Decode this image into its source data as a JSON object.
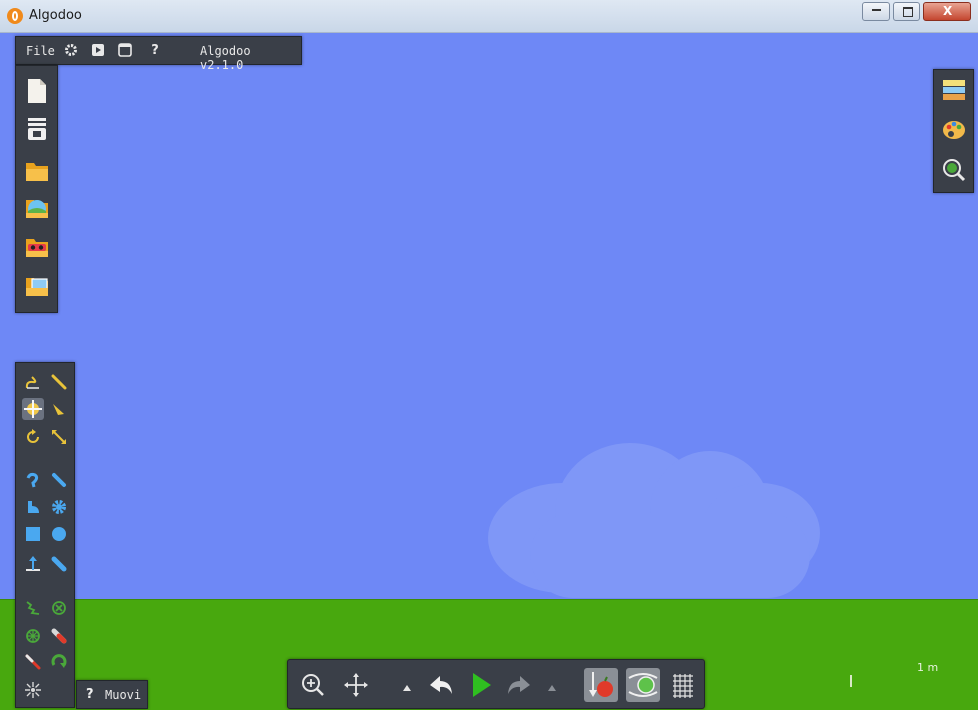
{
  "window": {
    "title": "Algodoo"
  },
  "menubar": {
    "file_label": "File",
    "version": "Algodoo v2.1.0",
    "icons": [
      "gear-icon",
      "play-box-icon",
      "window-icon",
      "help-icon"
    ],
    "help_label": "?"
  },
  "file_panel": {
    "icons": [
      "new-scene-icon",
      "save-scene-icon",
      "open-folder-icon",
      "open-phunlet-icon",
      "browse-algobox-icon",
      "open-image-icon"
    ]
  },
  "tool_panel": {
    "icons": [
      "sketch-tool-icon",
      "knife-tool-icon",
      "move-tool-icon",
      "drag-tool-icon",
      "rotate-tool-icon",
      "scale-tool-icon",
      "rope-tool-icon",
      "pen-tool-icon",
      "brush-tool-icon",
      "gear-tool-icon",
      "box-tool-icon",
      "circle-tool-icon",
      "plane-tool-icon",
      "chain-tool-icon",
      "spring-tool-icon",
      "fixate-tool-icon",
      "axle-tool-icon",
      "thruster-tool-icon",
      "tracer-tool-icon",
      "hinge-tool-icon",
      "laser-tool-icon"
    ]
  },
  "help": {
    "icon": "?",
    "label": "Muovi"
  },
  "right_panel": {
    "icons": [
      "background-layers-icon",
      "palette-icon",
      "zoom-to-scene-icon"
    ]
  },
  "bottom_bar": {
    "icons": [
      "zoom-icon",
      "pan-icon",
      "undo-dropdown-icon",
      "undo-icon",
      "play-icon",
      "redo-icon",
      "redo-dropdown-icon",
      "gravity-icon",
      "air-friction-icon",
      "grid-icon"
    ]
  },
  "scale": {
    "label": "1 m"
  },
  "colors": {
    "sky": "#6e88f6",
    "ground": "#48a80e",
    "panel": "#3a3f48",
    "play_green": "#2fbf20"
  }
}
